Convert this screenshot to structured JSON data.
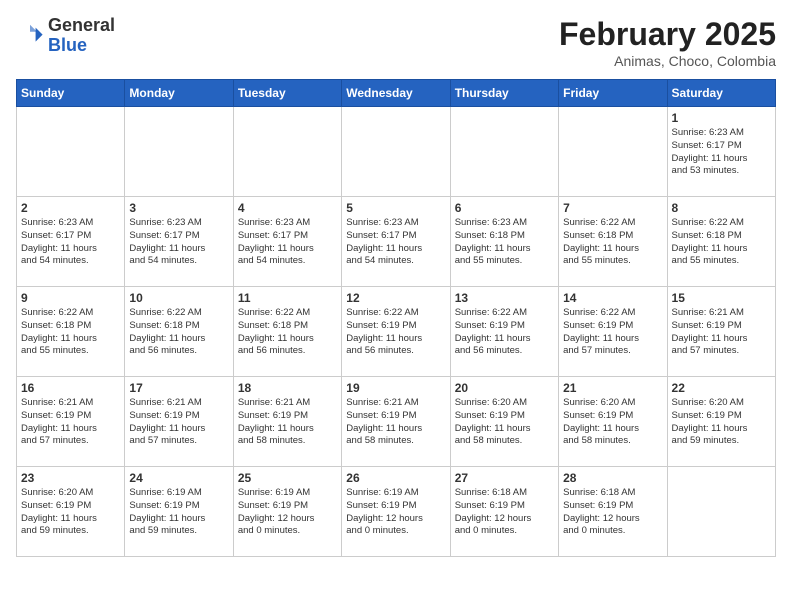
{
  "header": {
    "logo_general": "General",
    "logo_blue": "Blue",
    "month_title": "February 2025",
    "location": "Animas, Choco, Colombia"
  },
  "weekdays": [
    "Sunday",
    "Monday",
    "Tuesday",
    "Wednesday",
    "Thursday",
    "Friday",
    "Saturday"
  ],
  "weeks": [
    [
      {
        "day": "",
        "info": ""
      },
      {
        "day": "",
        "info": ""
      },
      {
        "day": "",
        "info": ""
      },
      {
        "day": "",
        "info": ""
      },
      {
        "day": "",
        "info": ""
      },
      {
        "day": "",
        "info": ""
      },
      {
        "day": "1",
        "info": "Sunrise: 6:23 AM\nSunset: 6:17 PM\nDaylight: 11 hours\nand 53 minutes."
      }
    ],
    [
      {
        "day": "2",
        "info": "Sunrise: 6:23 AM\nSunset: 6:17 PM\nDaylight: 11 hours\nand 54 minutes."
      },
      {
        "day": "3",
        "info": "Sunrise: 6:23 AM\nSunset: 6:17 PM\nDaylight: 11 hours\nand 54 minutes."
      },
      {
        "day": "4",
        "info": "Sunrise: 6:23 AM\nSunset: 6:17 PM\nDaylight: 11 hours\nand 54 minutes."
      },
      {
        "day": "5",
        "info": "Sunrise: 6:23 AM\nSunset: 6:17 PM\nDaylight: 11 hours\nand 54 minutes."
      },
      {
        "day": "6",
        "info": "Sunrise: 6:23 AM\nSunset: 6:18 PM\nDaylight: 11 hours\nand 55 minutes."
      },
      {
        "day": "7",
        "info": "Sunrise: 6:22 AM\nSunset: 6:18 PM\nDaylight: 11 hours\nand 55 minutes."
      },
      {
        "day": "8",
        "info": "Sunrise: 6:22 AM\nSunset: 6:18 PM\nDaylight: 11 hours\nand 55 minutes."
      }
    ],
    [
      {
        "day": "9",
        "info": "Sunrise: 6:22 AM\nSunset: 6:18 PM\nDaylight: 11 hours\nand 55 minutes."
      },
      {
        "day": "10",
        "info": "Sunrise: 6:22 AM\nSunset: 6:18 PM\nDaylight: 11 hours\nand 56 minutes."
      },
      {
        "day": "11",
        "info": "Sunrise: 6:22 AM\nSunset: 6:18 PM\nDaylight: 11 hours\nand 56 minutes."
      },
      {
        "day": "12",
        "info": "Sunrise: 6:22 AM\nSunset: 6:19 PM\nDaylight: 11 hours\nand 56 minutes."
      },
      {
        "day": "13",
        "info": "Sunrise: 6:22 AM\nSunset: 6:19 PM\nDaylight: 11 hours\nand 56 minutes."
      },
      {
        "day": "14",
        "info": "Sunrise: 6:22 AM\nSunset: 6:19 PM\nDaylight: 11 hours\nand 57 minutes."
      },
      {
        "day": "15",
        "info": "Sunrise: 6:21 AM\nSunset: 6:19 PM\nDaylight: 11 hours\nand 57 minutes."
      }
    ],
    [
      {
        "day": "16",
        "info": "Sunrise: 6:21 AM\nSunset: 6:19 PM\nDaylight: 11 hours\nand 57 minutes."
      },
      {
        "day": "17",
        "info": "Sunrise: 6:21 AM\nSunset: 6:19 PM\nDaylight: 11 hours\nand 57 minutes."
      },
      {
        "day": "18",
        "info": "Sunrise: 6:21 AM\nSunset: 6:19 PM\nDaylight: 11 hours\nand 58 minutes."
      },
      {
        "day": "19",
        "info": "Sunrise: 6:21 AM\nSunset: 6:19 PM\nDaylight: 11 hours\nand 58 minutes."
      },
      {
        "day": "20",
        "info": "Sunrise: 6:20 AM\nSunset: 6:19 PM\nDaylight: 11 hours\nand 58 minutes."
      },
      {
        "day": "21",
        "info": "Sunrise: 6:20 AM\nSunset: 6:19 PM\nDaylight: 11 hours\nand 58 minutes."
      },
      {
        "day": "22",
        "info": "Sunrise: 6:20 AM\nSunset: 6:19 PM\nDaylight: 11 hours\nand 59 minutes."
      }
    ],
    [
      {
        "day": "23",
        "info": "Sunrise: 6:20 AM\nSunset: 6:19 PM\nDaylight: 11 hours\nand 59 minutes."
      },
      {
        "day": "24",
        "info": "Sunrise: 6:19 AM\nSunset: 6:19 PM\nDaylight: 11 hours\nand 59 minutes."
      },
      {
        "day": "25",
        "info": "Sunrise: 6:19 AM\nSunset: 6:19 PM\nDaylight: 12 hours\nand 0 minutes."
      },
      {
        "day": "26",
        "info": "Sunrise: 6:19 AM\nSunset: 6:19 PM\nDaylight: 12 hours\nand 0 minutes."
      },
      {
        "day": "27",
        "info": "Sunrise: 6:18 AM\nSunset: 6:19 PM\nDaylight: 12 hours\nand 0 minutes."
      },
      {
        "day": "28",
        "info": "Sunrise: 6:18 AM\nSunset: 6:19 PM\nDaylight: 12 hours\nand 0 minutes."
      },
      {
        "day": "",
        "info": ""
      }
    ]
  ]
}
